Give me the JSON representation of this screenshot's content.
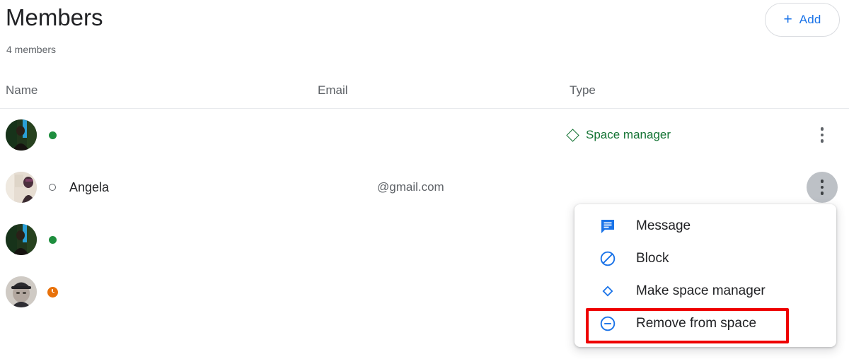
{
  "header": {
    "title": "Members",
    "subtitle": "4 members",
    "add_button": {
      "label": "Add",
      "icon": "plus-icon",
      "plus_glyph": "+"
    }
  },
  "table": {
    "columns": [
      "Name",
      "Email",
      "Type"
    ],
    "rows": [
      {
        "avatar": "avatar-photo-foliage",
        "status": "online",
        "status_icon": "green-dot-icon",
        "name": "",
        "email": "",
        "type": "Space manager",
        "type_icon": "diamond-icon",
        "menu_icon": "more-vert-icon",
        "menu_active": false
      },
      {
        "avatar": "avatar-photo-beige",
        "status": "offline",
        "status_icon": "hollow-circle-icon",
        "name": "Angela",
        "email": "@gmail.com",
        "type": "",
        "type_icon": "",
        "menu_icon": "more-vert-icon",
        "menu_active": true
      },
      {
        "avatar": "avatar-photo-foliage",
        "status": "online",
        "status_icon": "green-dot-icon",
        "name": "",
        "email": "",
        "type": "",
        "type_icon": "",
        "menu_icon": "more-vert-icon",
        "menu_active": false
      },
      {
        "avatar": "avatar-photo-cap",
        "status": "away",
        "status_icon": "orange-clock-icon",
        "name": "",
        "email": "",
        "type": "",
        "type_icon": "",
        "menu_icon": "more-vert-icon",
        "menu_active": false
      }
    ]
  },
  "popup_menu": {
    "items": [
      {
        "label": "Message",
        "icon": "message-icon"
      },
      {
        "label": "Block",
        "icon": "block-icon"
      },
      {
        "label": "Make space manager",
        "icon": "diamond-icon"
      },
      {
        "label": "Remove from space",
        "icon": "remove-circle-icon"
      }
    ],
    "highlighted_index": 3
  },
  "colors": {
    "accent_blue": "#1a73e8",
    "status_online": "#1e8e3e",
    "status_away": "#e8710a",
    "type_green": "#137333",
    "highlight_red": "#ee0000",
    "text_primary": "#202124",
    "text_secondary": "#5f6368"
  }
}
